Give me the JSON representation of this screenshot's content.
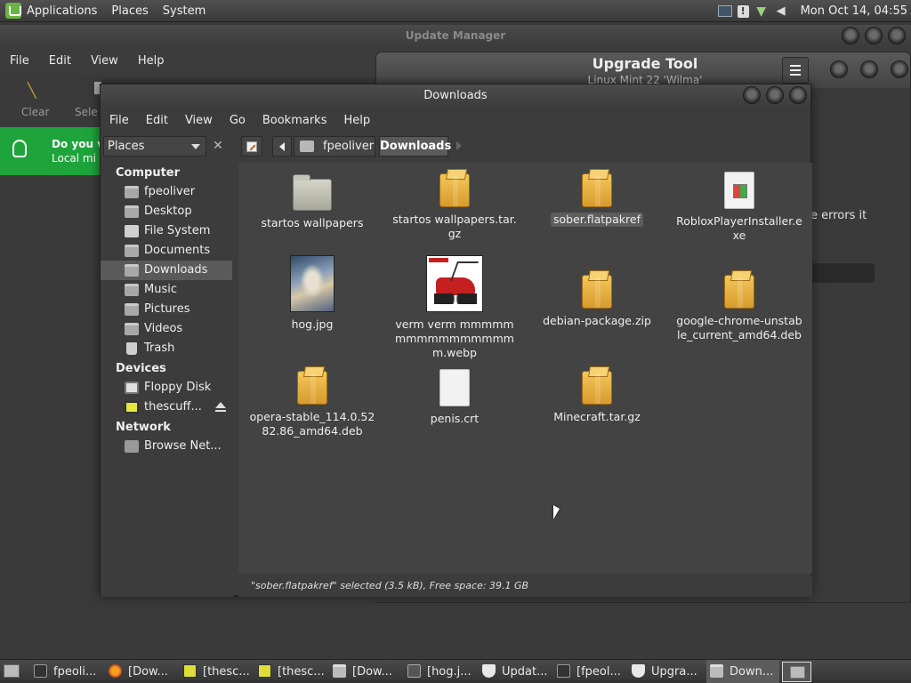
{
  "top_panel": {
    "menus": [
      "Applications",
      "Places",
      "System"
    ],
    "clock": "Mon Oct 14, 04:55"
  },
  "update_manager": {
    "title": "Update Manager",
    "menus": [
      "File",
      "Edit",
      "View",
      "Help"
    ],
    "toolbar": {
      "clear_label": "Clear",
      "select_label": "Sele"
    },
    "banner": {
      "line1": "Do you v",
      "line2": "Local mi"
    }
  },
  "upgrade_tool": {
    "title": "Upgrade Tool",
    "subtitle": "Linux Mint 22 'Wilma'",
    "body_text": "e errors it"
  },
  "file_manager": {
    "title": "Downloads",
    "menus": [
      "File",
      "Edit",
      "View",
      "Go",
      "Bookmarks",
      "Help"
    ],
    "places_label": "Places",
    "breadcrumb": {
      "home": "fpeoliver",
      "current": "Downloads"
    },
    "sidebar": {
      "computer_header": "Computer",
      "computer_items": [
        "fpeoliver",
        "Desktop",
        "File System",
        "Documents",
        "Downloads",
        "Music",
        "Pictures",
        "Videos",
        "Trash"
      ],
      "devices_header": "Devices",
      "device_items": [
        "Floppy Disk",
        "thescuff..."
      ],
      "network_header": "Network",
      "network_items": [
        "Browse Net..."
      ]
    },
    "files": [
      {
        "name": "startos wallpapers",
        "icon": "folder-icon"
      },
      {
        "name": "startos wallpapers.tar.gz",
        "icon": "archive-icon"
      },
      {
        "name": "sober.flatpakref",
        "icon": "archive-icon",
        "selected": true
      },
      {
        "name": "RobloxPlayerInstaller.exe",
        "icon": "exe-icon"
      },
      {
        "name": "hog.jpg",
        "icon": "image-thumbnail"
      },
      {
        "name": "verm verm mmmmmmmmmmmmmmmmm.webp",
        "icon": "image-thumbnail"
      },
      {
        "name": "debian-package.zip",
        "icon": "archive-icon"
      },
      {
        "name": "google-chrome-unstable_current_amd64.deb",
        "icon": "archive-icon"
      },
      {
        "name": "opera-stable_114.0.5282.86_amd64.deb",
        "icon": "archive-icon"
      },
      {
        "name": "penis.crt",
        "icon": "document-icon"
      },
      {
        "name": "Minecraft.tar.gz",
        "icon": "archive-icon"
      }
    ],
    "status": "\"sober.flatpakref\" selected (3.5 kB), Free space: 39.1 GB"
  },
  "taskbar": {
    "tasks": [
      "fpeoli...",
      "[Dow...",
      "[thesc...",
      "[thesc...",
      "[Dow...",
      "[hog.j...",
      "Updat...",
      "[fpeol...",
      "Upgra...",
      "Down..."
    ]
  }
}
